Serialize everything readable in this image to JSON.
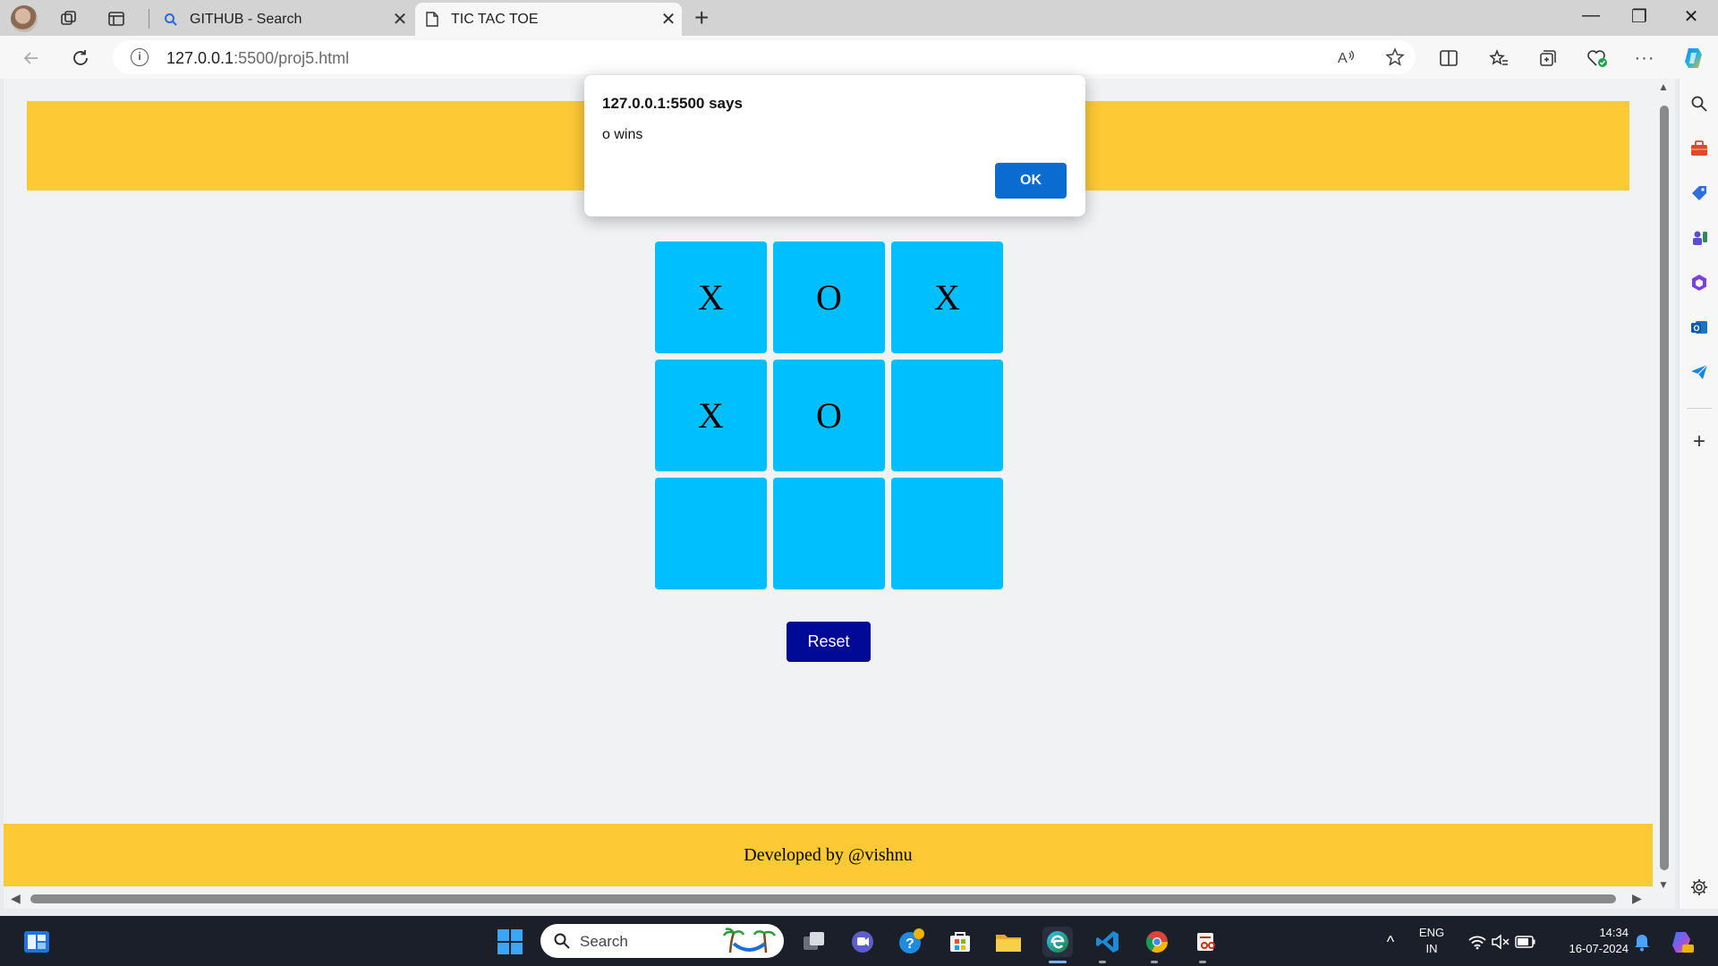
{
  "browser": {
    "tabs": [
      {
        "title": "GITHUB - Search",
        "favicon": "search-icon",
        "active": false
      },
      {
        "title": "TIC TAC TOE",
        "favicon": "page-icon",
        "active": true
      }
    ],
    "url_host": "127.0.0.1",
    "url_rest": ":5500/proj5.html"
  },
  "page": {
    "board": [
      "X",
      "O",
      "X",
      "X",
      "O",
      "",
      "",
      "",
      ""
    ],
    "reset_label": "Reset",
    "footer_text": "Developed by @vishnu",
    "colors": {
      "band": "#fdca35",
      "cell": "#00bfff",
      "reset": "#000a96"
    }
  },
  "dialog": {
    "title": "127.0.0.1:5500 says",
    "message": "o wins",
    "ok_label": "OK"
  },
  "taskbar": {
    "search_label": "Search",
    "lang_top": "ENG",
    "lang_bottom": "IN",
    "time": "14:34",
    "date": "16-07-2024"
  }
}
